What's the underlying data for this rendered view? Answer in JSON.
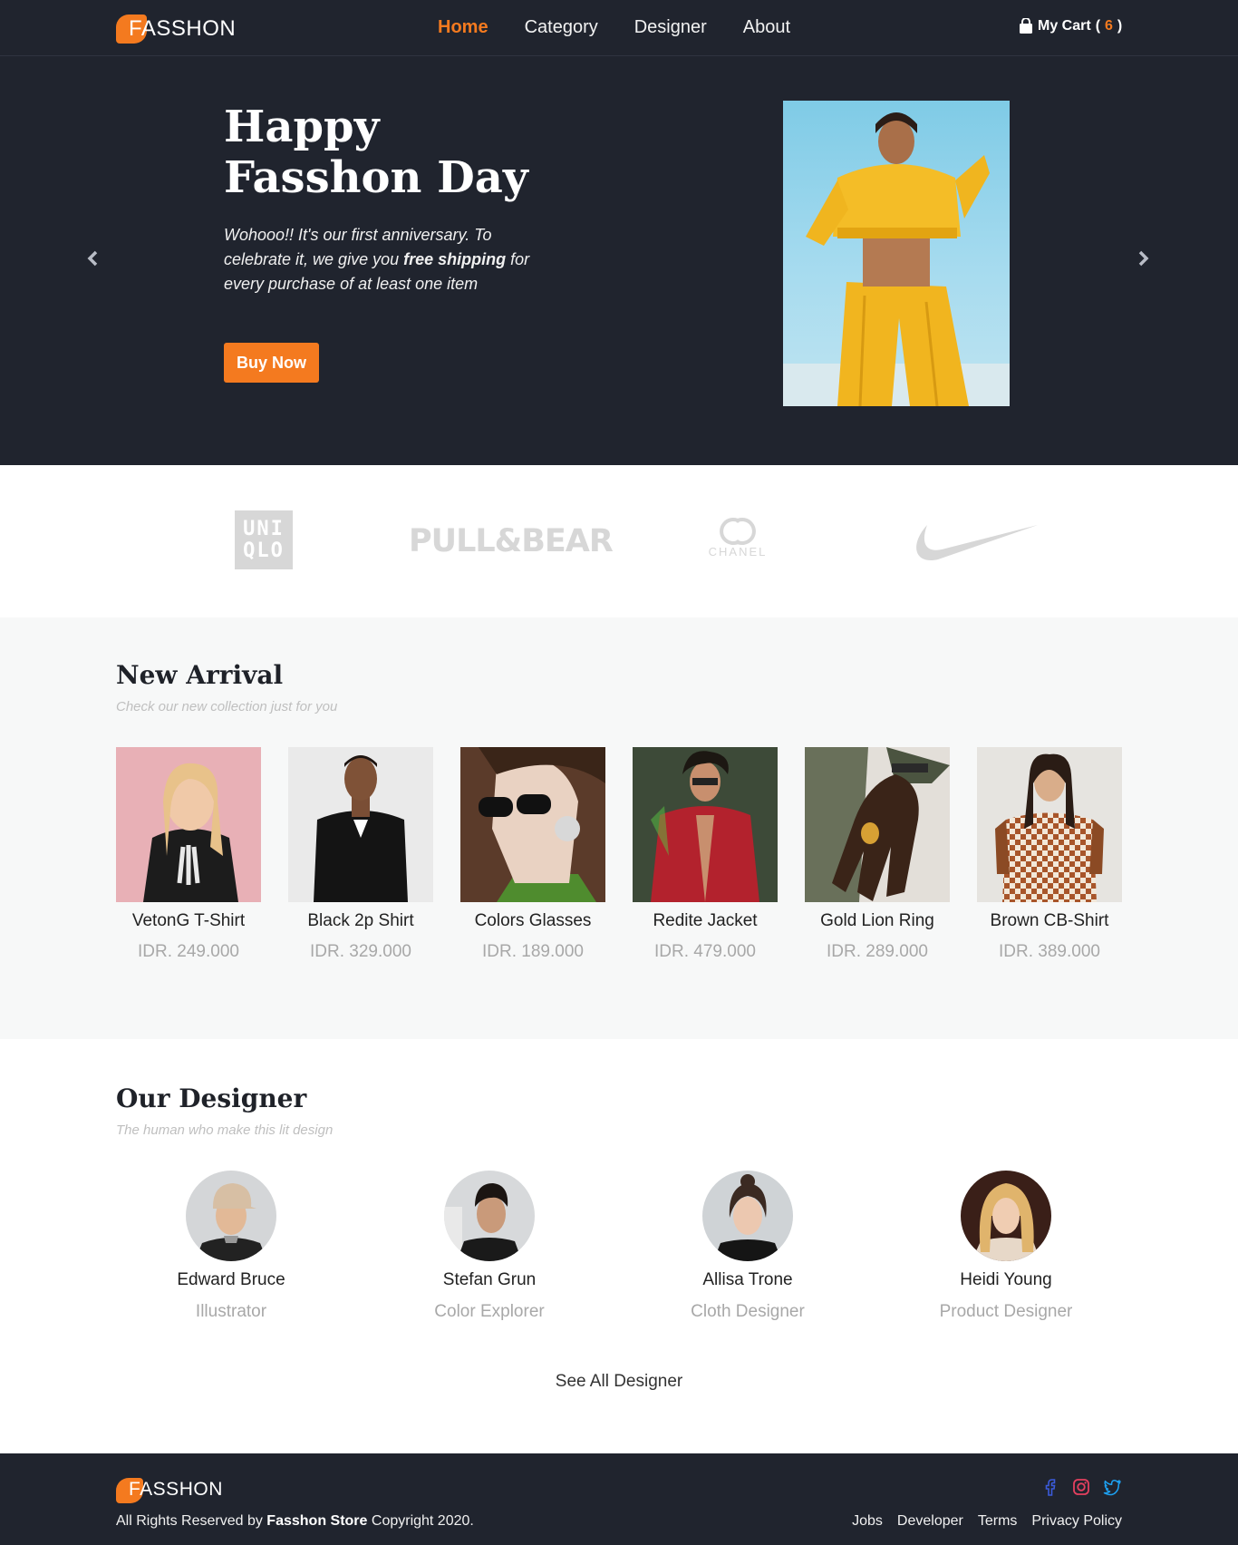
{
  "brand": {
    "logo_text": "FASSHON"
  },
  "nav": {
    "links": [
      "Home",
      "Category",
      "Designer",
      "About"
    ],
    "active": "Home",
    "cart_label": "My Cart",
    "cart_open": "(",
    "cart_count": "6",
    "cart_close": ")"
  },
  "hero": {
    "title_line1": "Happy",
    "title_line2": "Fasshon Day",
    "text_before": "Wohooo!! It's our first anniversary. To celebrate it, we give you ",
    "text_bold": "free shipping",
    "text_after": " for every purchase of at least one item",
    "button": "Buy Now"
  },
  "partner_brands": {
    "uniqlo_top": "UNI",
    "uniqlo_bottom": "QLO",
    "pullbear": "PULL&BEAR",
    "chanel": "CHANEL",
    "nike": "nike-swoosh"
  },
  "new_arrival": {
    "title": "New Arrival",
    "subtitle": "Check our new collection just for you",
    "products": [
      {
        "name": "VetonG T-Shirt",
        "price": "IDR. 249.000"
      },
      {
        "name": "Black 2p Shirt",
        "price": "IDR. 329.000"
      },
      {
        "name": "Colors Glasses",
        "price": "IDR. 189.000"
      },
      {
        "name": "Redite Jacket",
        "price": "IDR. 479.000"
      },
      {
        "name": "Gold Lion Ring",
        "price": "IDR. 289.000"
      },
      {
        "name": "Brown CB-Shirt",
        "price": "IDR. 389.000"
      }
    ]
  },
  "designers": {
    "title": "Our Designer",
    "subtitle": "The human who make this lit design",
    "list": [
      {
        "name": "Edward Bruce",
        "role": "Illustrator"
      },
      {
        "name": "Stefan Grun",
        "role": "Color Explorer"
      },
      {
        "name": "Allisa Trone",
        "role": "Cloth Designer"
      },
      {
        "name": "Heidi Young",
        "role": "Product Designer"
      }
    ],
    "see_all": "See All Designer"
  },
  "footer": {
    "logo_text": "FASSHON",
    "rights_before": "All Rights Reserved by ",
    "rights_bold": "Fasshon Store",
    "rights_after": " Copyright 2020.",
    "links": [
      "Jobs",
      "Developer",
      "Terms",
      "Privacy Policy"
    ],
    "socials": [
      "facebook-icon",
      "instagram-icon",
      "twitter-icon"
    ]
  },
  "colors": {
    "dark": "#20242e",
    "accent": "#f47a1f",
    "light_bg": "#f7f8f8",
    "muted": "#a8a8a8"
  }
}
